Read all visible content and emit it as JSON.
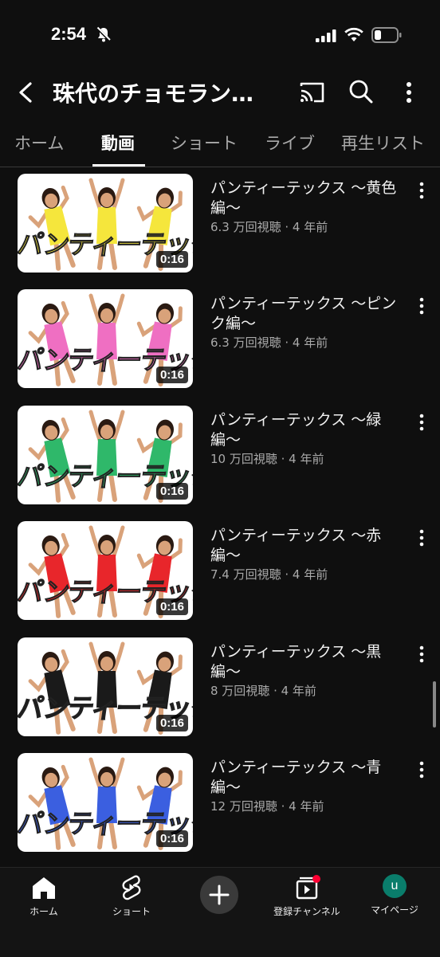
{
  "status_bar": {
    "time": "2:54"
  },
  "header": {
    "channel_title": "珠代のチョモラン…"
  },
  "tabs": [
    {
      "label": "ホーム",
      "active": false
    },
    {
      "label": "動画",
      "active": true
    },
    {
      "label": "ショート",
      "active": false
    },
    {
      "label": "ライブ",
      "active": false
    },
    {
      "label": "再生リスト",
      "active": false
    }
  ],
  "videos": [
    {
      "title": "パンティーテックス 〜黄色編〜",
      "meta": "6.3 万回視聴 · 4 年前",
      "duration": "0:16",
      "thumb_text": "パンティーテックス",
      "color": "#f5e63c"
    },
    {
      "title": "パンティーテックス 〜ピンク編〜",
      "meta": "6.3 万回視聴 · 4 年前",
      "duration": "0:16",
      "thumb_text": "パンティーテックス",
      "color": "#ef6fc2"
    },
    {
      "title": "パンティーテックス 〜緑編〜",
      "meta": "10 万回視聴 · 4 年前",
      "duration": "0:16",
      "thumb_text": "パンティーテックス",
      "color": "#2fb86a"
    },
    {
      "title": "パンティーテックス 〜赤編〜",
      "meta": "7.4 万回視聴 · 4 年前",
      "duration": "0:16",
      "thumb_text": "パンティーテックス",
      "color": "#e8262b"
    },
    {
      "title": "パンティーテックス 〜黒編〜",
      "meta": "8 万回視聴 · 4 年前",
      "duration": "0:16",
      "thumb_text": "パンティーテックス",
      "color": "#1a1a1a"
    },
    {
      "title": "パンティーテックス 〜青編〜",
      "meta": "12 万回視聴 · 4 年前",
      "duration": "0:16",
      "thumb_text": "パンティーテックス",
      "color": "#3b5fe0"
    }
  ],
  "bottom_nav": {
    "home": "ホーム",
    "shorts": "ショート",
    "subscriptions": "登録チャンネル",
    "you": "マイページ",
    "avatar_letter": "u"
  },
  "icons": {
    "back": "back-arrow-icon",
    "cast": "cast-icon",
    "search": "search-icon",
    "more": "more-vert-icon",
    "home": "home-icon",
    "shorts": "shorts-icon",
    "create": "plus-icon",
    "subscriptions": "subscriptions-icon"
  }
}
